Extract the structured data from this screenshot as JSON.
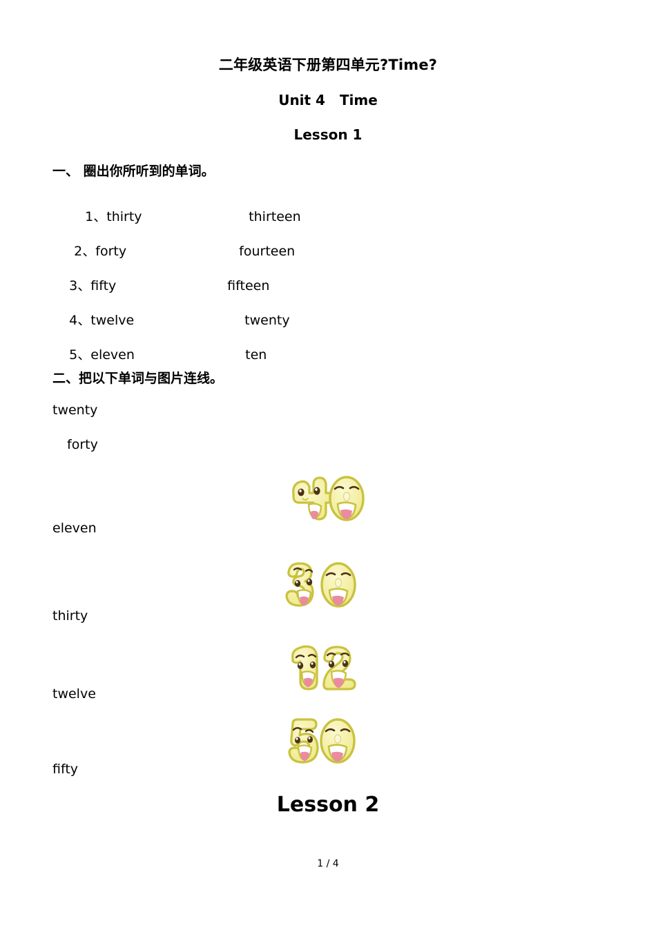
{
  "document": {
    "title": "二年级英语下册第四单元?Time?",
    "unit_title": "Unit 4   Time",
    "lesson_one": "Lesson 1",
    "lesson_two": "Lesson 2",
    "footer": "1 / 4"
  },
  "exercise_one": {
    "heading": "一、 圈出你所听到的单词。",
    "items": [
      {
        "number": "1、",
        "left": "thirty",
        "right": "thirteen"
      },
      {
        "number": "2、",
        "left": "forty",
        "right": "fourteen"
      },
      {
        "number": "3、",
        "left": "fifty",
        "right": "fifteen"
      },
      {
        "number": "4、",
        "left": "twelve",
        "right": "twenty"
      },
      {
        "number": "5、",
        "left": "eleven",
        "right": "ten"
      }
    ]
  },
  "exercise_two": {
    "heading": "二、把以下单词与图片连线。",
    "words": [
      "twenty",
      "forty",
      "eleven",
      "thirty",
      "twelve",
      "fifty"
    ],
    "pictures": [
      {
        "name": "number-40-cartoon",
        "digits": "40",
        "alt": "cartoon number forty"
      },
      {
        "name": "number-30-cartoon",
        "digits": "30",
        "alt": "cartoon number thirty"
      },
      {
        "name": "number-12-cartoon",
        "digits": "12",
        "alt": "cartoon number twelve"
      },
      {
        "name": "number-50-cartoon",
        "digits": "50",
        "alt": "cartoon number fifty"
      }
    ]
  },
  "colors": {
    "page_background": "#ffffff",
    "text": "#000000",
    "digit_fill": "#f4ef9a",
    "digit_fill_light": "#faf7c8",
    "digit_outline": "#c9c23f",
    "eye": "#4a3214",
    "tongue": "#ea8ba0",
    "mouth": "#ffffff"
  }
}
